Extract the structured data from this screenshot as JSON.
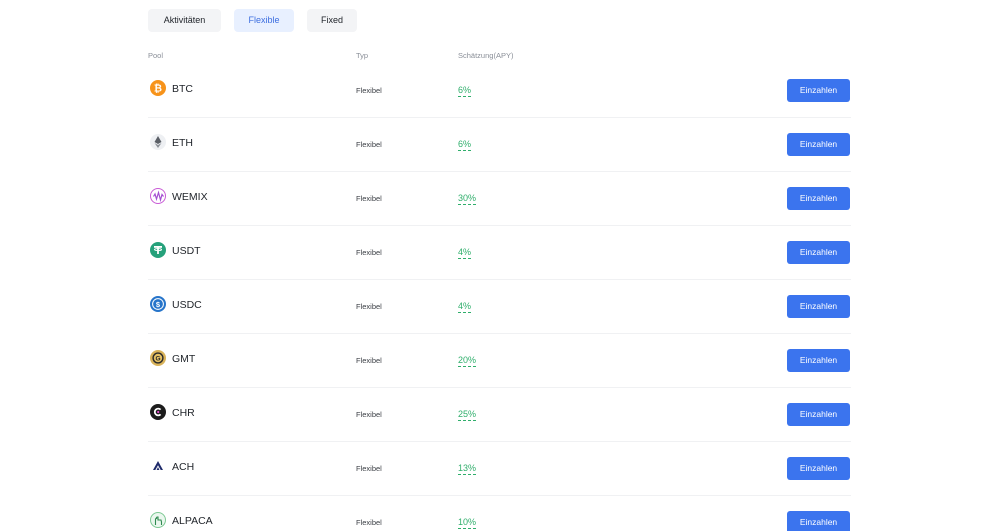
{
  "tabs": [
    {
      "label": "Aktivitäten"
    },
    {
      "label": "Flexible"
    },
    {
      "label": "Fixed"
    }
  ],
  "active_tab": "Flexible",
  "table": {
    "headers": {
      "pool": "Pool",
      "type": "Typ",
      "apy": "Schätzung(APY)"
    },
    "rows": [
      {
        "coin": "BTC",
        "icon": "btc-icon",
        "type": "Flexibel",
        "apy": "6%",
        "action": "Einzahlen"
      },
      {
        "coin": "ETH",
        "icon": "eth-icon",
        "type": "Flexibel",
        "apy": "6%",
        "action": "Einzahlen"
      },
      {
        "coin": "WEMIX",
        "icon": "wemix-icon",
        "type": "Flexibel",
        "apy": "30%",
        "action": "Einzahlen"
      },
      {
        "coin": "USDT",
        "icon": "usdt-icon",
        "type": "Flexibel",
        "apy": "4%",
        "action": "Einzahlen"
      },
      {
        "coin": "USDC",
        "icon": "usdc-icon",
        "type": "Flexibel",
        "apy": "4%",
        "action": "Einzahlen"
      },
      {
        "coin": "GMT",
        "icon": "gmt-icon",
        "type": "Flexibel",
        "apy": "20%",
        "action": "Einzahlen"
      },
      {
        "coin": "CHR",
        "icon": "chr-icon",
        "type": "Flexibel",
        "apy": "25%",
        "action": "Einzahlen"
      },
      {
        "coin": "ACH",
        "icon": "ach-icon",
        "type": "Flexibel",
        "apy": "13%",
        "action": "Einzahlen"
      },
      {
        "coin": "ALPACA",
        "icon": "alpaca-icon",
        "type": "Flexibel",
        "apy": "10%",
        "action": "Einzahlen"
      }
    ]
  },
  "colors": {
    "accent": "#3b74ee",
    "apy_green": "#2fae6b",
    "active_tab_bg": "#e8f0ff",
    "active_tab_text": "#3d6fe0"
  }
}
